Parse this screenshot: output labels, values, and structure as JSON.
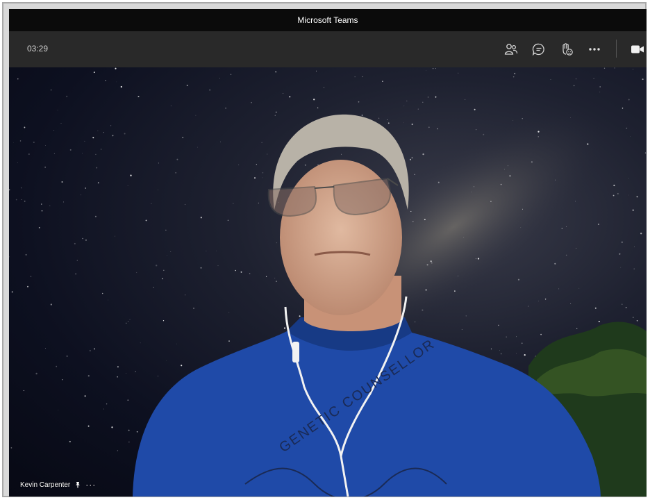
{
  "window": {
    "title": "Microsoft Teams"
  },
  "toolbar": {
    "timer": "03:29",
    "buttons": [
      {
        "icon": "people-icon"
      },
      {
        "icon": "chat-icon"
      },
      {
        "icon": "raise-hand-icon"
      },
      {
        "icon": "more-icon"
      },
      {
        "icon": "camera-icon"
      }
    ]
  },
  "participant": {
    "name": "Kevin Carpenter",
    "shirt_text": "GENETIC COUNSELLOR"
  },
  "colors": {
    "titlebar": "#0b0b0b",
    "toolbar": "#292929",
    "shirt": "#1f4aa8"
  }
}
